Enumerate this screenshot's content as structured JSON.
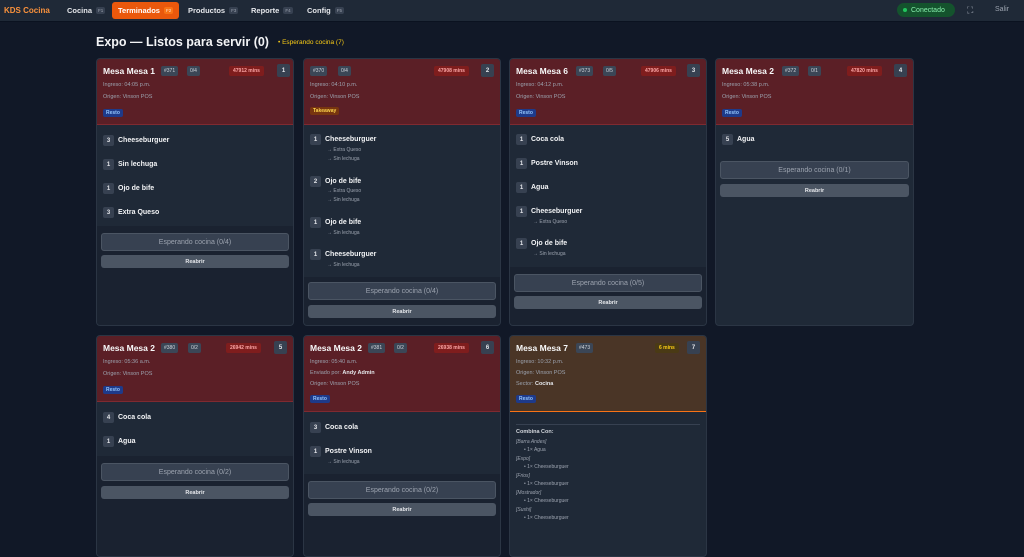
{
  "app": {
    "brand": "KDS Cocina",
    "nav": [
      {
        "label": "Cocina",
        "key": "F1"
      },
      {
        "label": "Terminados",
        "key": "F2"
      },
      {
        "label": "Productos",
        "key": "F3"
      },
      {
        "label": "Reporte",
        "key": "F4"
      },
      {
        "label": "Config",
        "key": "F5"
      }
    ],
    "status": "Conectado",
    "expand_glyph": "⛶",
    "logout": "Salir"
  },
  "page": {
    "title": "Expo — Listos para servir (0)",
    "waiting": "• Esperando cocina (7)"
  },
  "cards": [
    {
      "title": "Mesa Mesa 1",
      "order": "#371",
      "progress": "0/4",
      "mins": "47912 mins",
      "seat": "1",
      "meta": [
        "Ingreso: 04:05 p.m.",
        "Origen: Vinson POS"
      ],
      "tag": "Resto",
      "items": [
        {
          "qty": "3",
          "name": "Cheeseburguer",
          "mods": []
        },
        {
          "qty": "1",
          "name": "Sin lechuga",
          "mods": []
        },
        {
          "qty": "1",
          "name": "Ojo de bife",
          "mods": []
        },
        {
          "qty": "3",
          "name": "Extra Queso",
          "mods": []
        }
      ],
      "wait_label": "Esperando cocina (0/4)",
      "reopen_label": "Reabrir"
    },
    {
      "title": "",
      "order": "#370",
      "progress": "0/4",
      "mins": "47908 mins",
      "seat": "2",
      "meta": [
        "Ingreso: 04:10 p.m.",
        "Origen: Vinson POS"
      ],
      "tag": "Takeaway",
      "items": [
        {
          "qty": "1",
          "name": "Cheeseburguer",
          "mods": [
            "→ Extra Queso",
            "→ Sin lechuga"
          ]
        },
        {
          "qty": "2",
          "name": "Ojo de bife",
          "mods": [
            "→ Extra Queso",
            "→ Sin lechuga"
          ]
        },
        {
          "qty": "1",
          "name": "Ojo de bife",
          "mods": [
            "→ Sin lechuga"
          ]
        },
        {
          "qty": "1",
          "name": "Cheeseburguer",
          "mods": [
            "→ Sin lechuga"
          ]
        }
      ],
      "wait_label": "Esperando cocina (0/4)",
      "reopen_label": "Reabrir"
    },
    {
      "title": "Mesa Mesa 6",
      "order": "#373",
      "progress": "0/5",
      "mins": "47906 mins",
      "seat": "3",
      "meta": [
        "Ingreso: 04:12 p.m.",
        "Origen: Vinson POS"
      ],
      "tag": "Resto",
      "items": [
        {
          "qty": "1",
          "name": "Coca cola",
          "mods": []
        },
        {
          "qty": "1",
          "name": "Postre Vinson",
          "mods": []
        },
        {
          "qty": "1",
          "name": "Agua",
          "mods": []
        },
        {
          "qty": "1",
          "name": "Cheeseburguer",
          "mods": [
            "→ Extra Queso"
          ]
        },
        {
          "qty": "1",
          "name": "Ojo de bife",
          "mods": [
            "→ Sin lechuga"
          ]
        }
      ],
      "wait_label": "Esperando cocina (0/5)",
      "reopen_label": "Reabrir"
    },
    {
      "title": "Mesa Mesa 2",
      "order": "#372",
      "progress": "0/1",
      "mins": "47820 mins",
      "seat": "4",
      "meta": [
        "Ingreso: 05:38 p.m.",
        "Origen: Vinson POS"
      ],
      "tag": "Resto",
      "items": [
        {
          "qty": "5",
          "name": "Agua",
          "mods": []
        }
      ],
      "wait_label": "Esperando cocina (0/1)",
      "reopen_label": "Reabrir"
    },
    {
      "title": "Mesa Mesa 2",
      "order": "#380",
      "progress": "0/2",
      "mins": "26942 mins",
      "seat": "5",
      "meta": [
        "Ingreso: 05:36 a.m.",
        "Origen: Vinson POS"
      ],
      "tag": "Resto",
      "items": [
        {
          "qty": "4",
          "name": "Coca cola",
          "mods": []
        },
        {
          "qty": "1",
          "name": "Agua",
          "mods": []
        }
      ],
      "wait_label": "Esperando cocina (0/2)",
      "reopen_label": "Reabrir"
    },
    {
      "title": "Mesa Mesa 2",
      "order": "#381",
      "progress": "0/2",
      "mins": "26938 mins",
      "seat": "6",
      "meta": [
        "Ingreso: 05:40 a.m.",
        "Enviado por:",
        "Andy Admin",
        "Origen: Vinson POS"
      ],
      "tag": "Resto",
      "items": [
        {
          "qty": "3",
          "name": "Coca cola",
          "mods": []
        },
        {
          "qty": "1",
          "name": "Postre Vinson",
          "mods": [
            "→ Sin lechuga"
          ]
        }
      ],
      "wait_label": "Esperando cocina (0/2)",
      "reopen_label": "Reabrir"
    },
    {
      "title": "Mesa Mesa 7",
      "order": "#473",
      "progress": "",
      "mins": "6 mins",
      "seat": "7",
      "meta": [
        "Ingreso: 10:32 p.m.",
        "Origen: Vinson POS",
        "Sector:",
        "Cocina"
      ],
      "tag": "Resto",
      "combina": {
        "title": "Combina Con:",
        "groups": [
          {
            "name": "[Barra Andes]",
            "line": "• 1× Agua"
          },
          {
            "name": "[Expo]",
            "line": "• 1× Cheeseburguer"
          },
          {
            "name": "[Frios]",
            "line": "• 1× Cheeseburguer"
          },
          {
            "name": "[Mostrador]",
            "line": "• 1× Cheeseburguer"
          },
          {
            "name": "[Sushi]",
            "line": "• 1× Cheeseburguer"
          }
        ]
      }
    }
  ]
}
